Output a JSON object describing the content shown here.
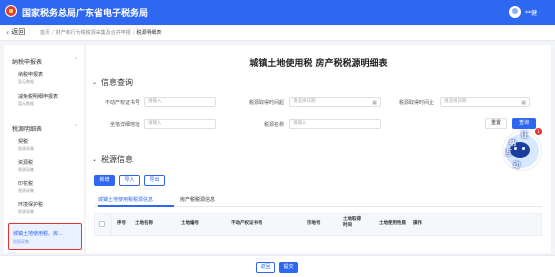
{
  "header": {
    "brand": "国家税务总局广东省电子税务局",
    "user_name": "**健",
    "brand_color": "#2f68f0"
  },
  "subheader": {
    "back_label": "返回",
    "breadcrumbs": [
      "首页",
      "财产和行为税税源采集及合并申报",
      "税源明细表"
    ]
  },
  "sidebar": {
    "groups": [
      {
        "label": "纳税申报表",
        "items": [
          {
            "label": "纳税申报表",
            "sub": "暂无数据"
          },
          {
            "label": "减免税明细申报表",
            "sub": "暂无数据"
          }
        ]
      },
      {
        "label": "税源明细表",
        "items": [
          {
            "label": "契税",
            "sub": "税源采集"
          },
          {
            "label": "资源税",
            "sub": "税源采集"
          },
          {
            "label": "印花税",
            "sub": "税源采集"
          },
          {
            "label": "环境保护税",
            "sub": "税源采集"
          },
          {
            "label": "城镇土地使用税、房...",
            "sub": "税源采集"
          }
        ]
      }
    ]
  },
  "main": {
    "title": "城镇土地使用税 房产税税源明细表",
    "query_section": {
      "heading": "信息查询",
      "fields": [
        {
          "label": "不动产权证书号",
          "placeholder": "请输入"
        },
        {
          "label": "税源取得时间起",
          "placeholder": "请选择日期"
        },
        {
          "label": "税源取得时间止",
          "placeholder": "请选择日期"
        },
        {
          "label": "坐落详细地址",
          "placeholder": "请输入"
        },
        {
          "label": "税源名称",
          "placeholder": "请输入"
        }
      ],
      "reset_label": "重置",
      "query_label": "查询"
    },
    "source_section": {
      "heading": "税源信息",
      "buttons": [
        "新增",
        "导入",
        "导出"
      ],
      "tabs": [
        "城镇土地使用税税源信息",
        "房产税税源信息"
      ],
      "columns": [
        "序号",
        "土地名称",
        "土地编号",
        "不动产权证书号",
        "宗地号",
        "土地取得时间",
        "土地使用性质",
        "操作"
      ]
    }
  },
  "footer": {
    "back_label": "返回",
    "submit_label": "提交"
  },
  "assistant": {
    "chars": [
      "征",
      "纳",
      "互",
      "动"
    ],
    "badge": "1"
  }
}
